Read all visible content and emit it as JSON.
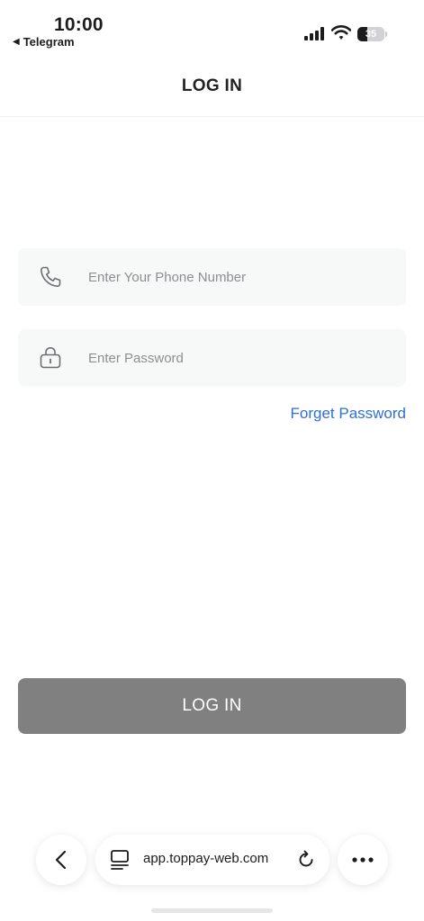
{
  "status_bar": {
    "time": "10:00",
    "back_app": "Telegram",
    "battery_level": "35",
    "battery_fraction": 0.35
  },
  "header": {
    "title": "LOG IN"
  },
  "form": {
    "phone_placeholder": "Enter Your Phone Number",
    "phone_value": "",
    "password_placeholder": "Enter Password",
    "password_value": "",
    "forgot_label": "Forget Password",
    "login_label": "LOG IN"
  },
  "browser": {
    "url": "app.toppay-web.com"
  },
  "icons": {
    "phone": "phone-icon",
    "lock": "lock-icon",
    "back": "chevron-left-icon",
    "tabs": "tabs-icon",
    "reload": "reload-icon",
    "more": "more-dots-icon"
  },
  "colors": {
    "accent_link": "#2f6fd6",
    "button_disabled": "#808080",
    "field_background": "#f7f8f8"
  }
}
